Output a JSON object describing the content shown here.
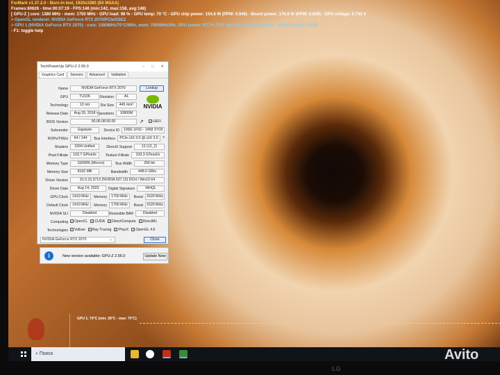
{
  "furmark": {
    "l1": "FurMark v1.37.2.0 - Burn-in test, 1920x1080 (8X MSAA)",
    "l2": "Frames:60626 - time:00:07:19 - FPS:146 (min:142, max:158, avg:148)",
    "l3": "[ GPU-Z ] core: 1380 MHz - mem: 1750 MHz - GPU load: 98 % - GPU temp: 70 °C - GPU chip power: 154.6 W (PPW: 0.946) - Board power: 176.8 W (PPW: 0.829) - GPU voltage: 0.743 V",
    "l4": "> OpenGL renderer: NVIDIA GeForce RTX 2070/PCIe/SSE2",
    "l5": "> GPU 1 (NVIDIA GeForce RTX 2070) - core: 1380MHz/70°C/98%, mem: 7000MHz/5%, GPU power: 97.7% TDP, fan: 59%, limits:[power:1, temp:0, volt:0, OV:0]",
    "l6": "- F1: toggle help",
    "graph_label": "GPU 1: 70°C (min: 28°C - max: 70°C)"
  },
  "gpuz": {
    "title": "TechPowerUp GPU-Z 2.55.0",
    "tabs": [
      "Graphics Card",
      "Sensors",
      "Advanced",
      "Validation"
    ],
    "name_label": "Name",
    "name": "NVIDIA GeForce RTX 2070",
    "lookup": "Lookup",
    "gpu_label": "GPU",
    "gpu": "TU106",
    "revision_label": "Revision",
    "revision": "A1",
    "tech_label": "Technology",
    "tech": "12 nm",
    "die_label": "Die Size",
    "die": "445 mm²",
    "release_label": "Release Date",
    "release": "Aug 20, 2018",
    "trans_label": "Transistors",
    "trans": "10800M",
    "vendor_logo": "NVIDIA",
    "bios_label": "BIOS Version",
    "bios": "90.06.08.00.00",
    "uefi": "UEFI",
    "subvendor_label": "Subvendor",
    "subvendor": "Gigabyte",
    "devid_label": "Device ID",
    "devid": "10DE 1F02 - 1458 37C8",
    "rops_label": "ROPs/TMUs",
    "rops": "64 / 144",
    "bus_label": "Bus Interface",
    "bus": "PCIe x16 3.0 @ x16 3.0",
    "help": "?",
    "shaders_label": "Shaders",
    "shaders": "2304 Unified",
    "dx_label": "DirectX Support",
    "dx": "12 (12_2)",
    "pixel_label": "Pixel Fillrate",
    "pixel": "103.7 GPixel/s",
    "texture_label": "Texture Fillrate",
    "texture": "233.3 GTexel/s",
    "memtype_label": "Memory Type",
    "memtype": "GDDR6 (Micron)",
    "buswidth_label": "Bus Width",
    "buswidth": "256 bit",
    "memsize_label": "Memory Size",
    "memsize": "8192 MB",
    "bandwidth_label": "Bandwidth",
    "bandwidth": "448.0 GB/s",
    "driver_label": "Driver Version",
    "driver": "31.0.15.3713 (NVIDIA 537.13) DCH / Win10 64",
    "driverdate_label": "Driver Date",
    "driverdate": "Aug 14, 2023",
    "sig_label": "Digital Signature",
    "sig": "WHQL",
    "gpuclock_label": "GPU Clock",
    "gpuclock": "1410 MHz",
    "mem_label": "Memory",
    "memclock": "1750 MHz",
    "boost_label": "Boost",
    "boost": "1620 MHz",
    "defclock_label": "Default Clock",
    "defclock": "1410 MHz",
    "defmem": "1750 MHz",
    "defboost": "1620 MHz",
    "sli_label": "NVIDIA SLI",
    "sli": "Disabled",
    "bar_label": "Resizable BAR",
    "bar": "Disabled",
    "computing_label": "Computing",
    "computing": [
      "OpenCL",
      "CUDA",
      "DirectCompute",
      "DirectML"
    ],
    "techs_label": "Technologies",
    "techs": [
      "Vulkan",
      "Ray Tracing",
      "PhysX",
      "OpenGL 4.6"
    ],
    "selected_gpu": "NVIDIA GeForce RTX 2070",
    "close": "Close"
  },
  "notification": {
    "text": "New version available: GPU-Z 2.56.0",
    "button": "Update Now"
  },
  "taskbar": {
    "search_placeholder": "Поиск"
  },
  "monitor_brand": "LG",
  "watermark": "Avito"
}
